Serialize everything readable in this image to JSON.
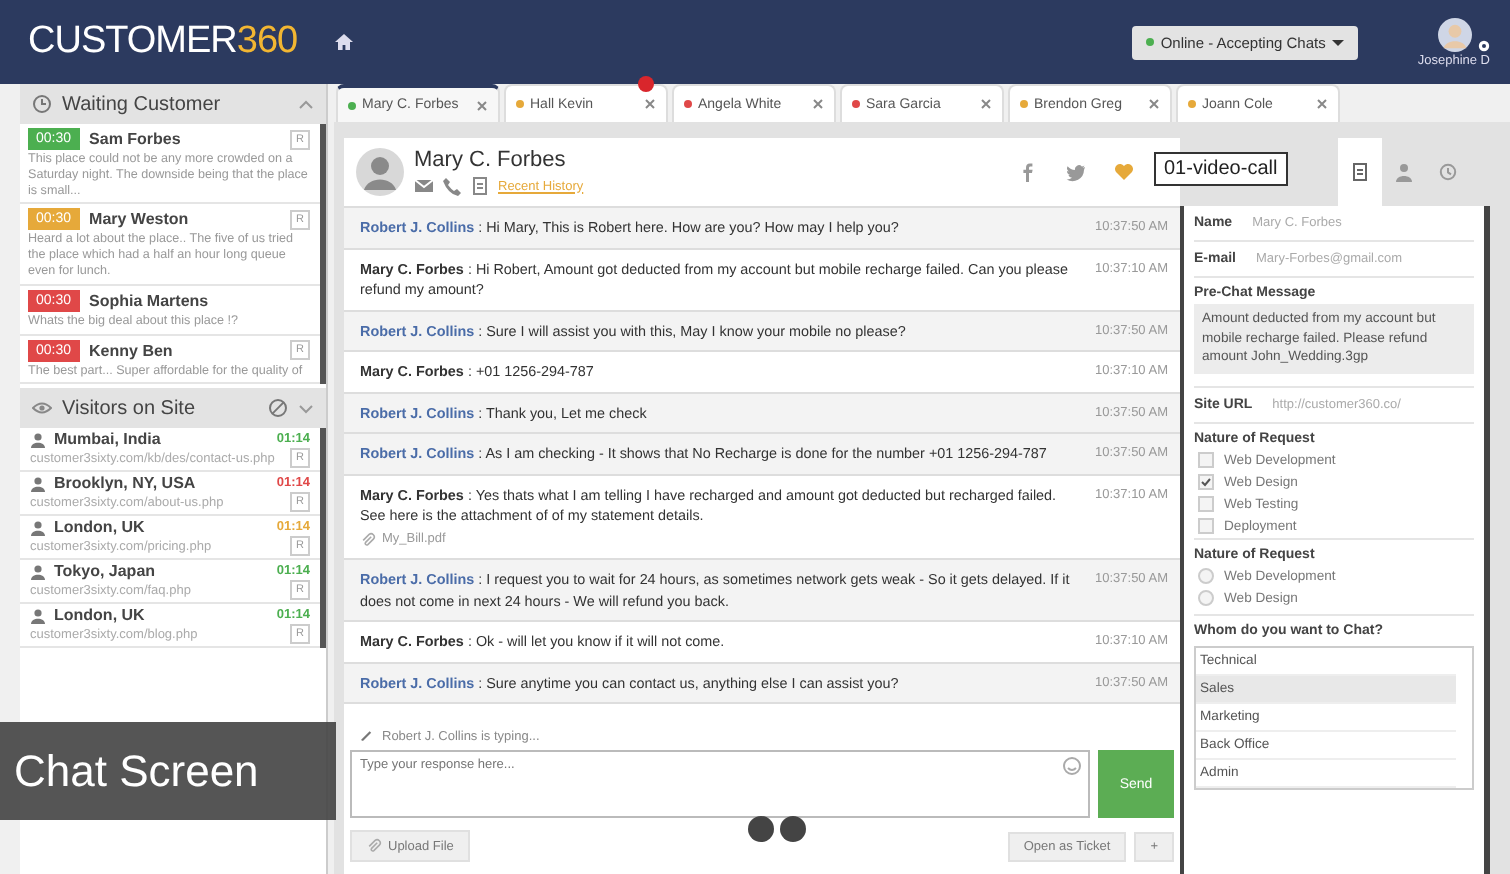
{
  "header": {
    "logo": {
      "text": "CUSTOMER",
      "accent": "360"
    },
    "status": "Online - Accepting Chats",
    "user": "Josephine D"
  },
  "waiting": {
    "title": "Waiting Customer",
    "items": [
      {
        "timer": "00:30",
        "color": "#4caf50",
        "name": "Sam Forbes",
        "tag": "R",
        "message": "This place could not be any more crowded on a Saturday night. The downside being that the place is small..."
      },
      {
        "timer": "00:30",
        "color": "#e6a93a",
        "name": "Mary Weston",
        "tag": "R",
        "message": "Heard a lot about the place.. The five of us tried the place which had a half an hour long queue even for lunch."
      },
      {
        "timer": "00:30",
        "color": "#e04848",
        "name": "Sophia Martens",
        "message": "Whats the big deal about this place !?"
      },
      {
        "timer": "00:30",
        "color": "#e04848",
        "name": "Kenny Ben",
        "tag": "R",
        "message": "The best part... Super affordable for the quality of"
      }
    ]
  },
  "visitors": {
    "title": "Visitors on Site",
    "items": [
      {
        "location": "Mumbai, India",
        "url": "customer3sixty.com/kb/des/contact-us.php",
        "time": "01:14",
        "color": "#4caf50",
        "tag": "R"
      },
      {
        "location": "Brooklyn, NY, USA",
        "url": "customer3sixty.com/about-us.php",
        "time": "01:14",
        "color": "#e04848",
        "tag": "R"
      },
      {
        "location": "London, UK",
        "url": "customer3sixty.com/pricing.php",
        "time": "01:14",
        "color": "#e6a93a",
        "tag": "R"
      },
      {
        "location": "Tokyo, Japan",
        "url": "customer3sixty.com/faq.php",
        "time": "01:14",
        "color": "#4caf50",
        "tag": "R"
      },
      {
        "location": "London, UK",
        "url": "customer3sixty.com/blog.php",
        "time": "01:14",
        "color": "#4caf50",
        "tag": "R"
      }
    ]
  },
  "tabs": [
    {
      "label": "Mary C. Forbes",
      "color": "#4caf50",
      "selected": true
    },
    {
      "label": "Hall Kevin",
      "color": "#e6a93a",
      "selected": false,
      "badge": true
    },
    {
      "label": "Angela White",
      "color": "#e04848",
      "selected": false
    },
    {
      "label": "Sara Garcia",
      "color": "#e04848",
      "selected": false
    },
    {
      "label": "Brendon Greg",
      "color": "#e6a93a",
      "selected": false
    },
    {
      "label": "Joann Cole",
      "color": "#e6a93a",
      "selected": false
    }
  ],
  "chat": {
    "name": "Mary C. Forbes",
    "separator": ":",
    "history_link": "Recent History",
    "tooltip": "01-video-call",
    "messages": [
      {
        "kind": "agent",
        "sender": "Robert J. Collins",
        "text": "Hi Mary, This is Robert here. How are you? How may I help you?",
        "time": "10:37:50 AM"
      },
      {
        "kind": "customer",
        "sender": "Mary C. Forbes",
        "text": "Hi Robert, Amount got deducted from my account but mobile recharge failed. Can you please refund my amount?",
        "time": "10:37:10 AM"
      },
      {
        "kind": "agent",
        "sender": "Robert J. Collins",
        "text": "Sure I will assist you with this, May I know your mobile no please?",
        "time": "10:37:50 AM"
      },
      {
        "kind": "customer",
        "sender": "Mary C. Forbes",
        "text": "+01 1256-294-787",
        "time": "10:37:10 AM"
      },
      {
        "kind": "agent",
        "sender": "Robert J. Collins",
        "text": "Thank you, Let me check",
        "time": "10:37:50 AM"
      },
      {
        "kind": "agent",
        "sender": "Robert J. Collins",
        "text": "As I am checking - It shows that No Recharge is done for the number +01 1256-294-787",
        "time": "10:37:50 AM"
      },
      {
        "kind": "customer",
        "sender": "Mary C. Forbes",
        "text": "Yes thats what I am telling I have recharged and amount got deducted but recharged failed. See here is the attachment of of my statement details.",
        "attachment": "My_Bill.pdf",
        "time": "10:37:10 AM"
      },
      {
        "kind": "agent",
        "sender": "Robert J. Collins",
        "text": "I request you to wait for 24 hours, as sometimes network gets weak - So it gets delayed. If it does not come in next 24 hours - We will refund you back.",
        "time": "10:37:50 AM"
      },
      {
        "kind": "customer",
        "sender": "Mary C. Forbes",
        "text": "Ok - will let you know if it will not come.",
        "time": "10:37:10 AM"
      },
      {
        "kind": "agent",
        "sender": "Robert J. Collins",
        "text": "Sure anytime you can contact us, anything else I can assist you?",
        "time": "10:37:50 AM"
      }
    ],
    "typing": "Robert J. Collins is typing...",
    "input": {
      "placeholder": "Type your response here..."
    },
    "send": "Send",
    "upload": "Upload File",
    "ticket": "Open as Ticket",
    "plus": "+"
  },
  "details": {
    "tabs": [
      {
        "kind": "notes",
        "selected": true
      },
      {
        "kind": "profile",
        "selected": false
      },
      {
        "kind": "history",
        "selected": false
      }
    ],
    "name_label": "Name",
    "name": "Mary C. Forbes",
    "email_label": "E-mail",
    "email": "Mary-Forbes@gmail.com",
    "prechat_label": "Pre-Chat Message",
    "prechat": "Amount deducted from my account but mobile recharge failed. Please refund amount John_Wedding.3gp",
    "url_label": "Site URL",
    "url": "http://customer360.co/",
    "request_label": "Nature of Request",
    "checks": [
      {
        "label": "Web Development",
        "checked": false
      },
      {
        "label": "Web Design",
        "checked": true
      },
      {
        "label": "Web Testing",
        "checked": false
      },
      {
        "label": "Deployment",
        "checked": false
      }
    ],
    "request_label_2": "Nature of Request",
    "radios": [
      {
        "label": "Web Development",
        "selected": false
      },
      {
        "label": "Web Design",
        "selected": false
      }
    ],
    "whom_label": "Whom do you want to Chat?",
    "options": [
      {
        "label": "Technical",
        "selected": false
      },
      {
        "label": "Sales",
        "selected": true
      },
      {
        "label": "Marketing",
        "selected": false
      },
      {
        "label": "Back Office",
        "selected": false
      },
      {
        "label": "Admin",
        "selected": false
      }
    ]
  },
  "caption": "Chat Screen"
}
